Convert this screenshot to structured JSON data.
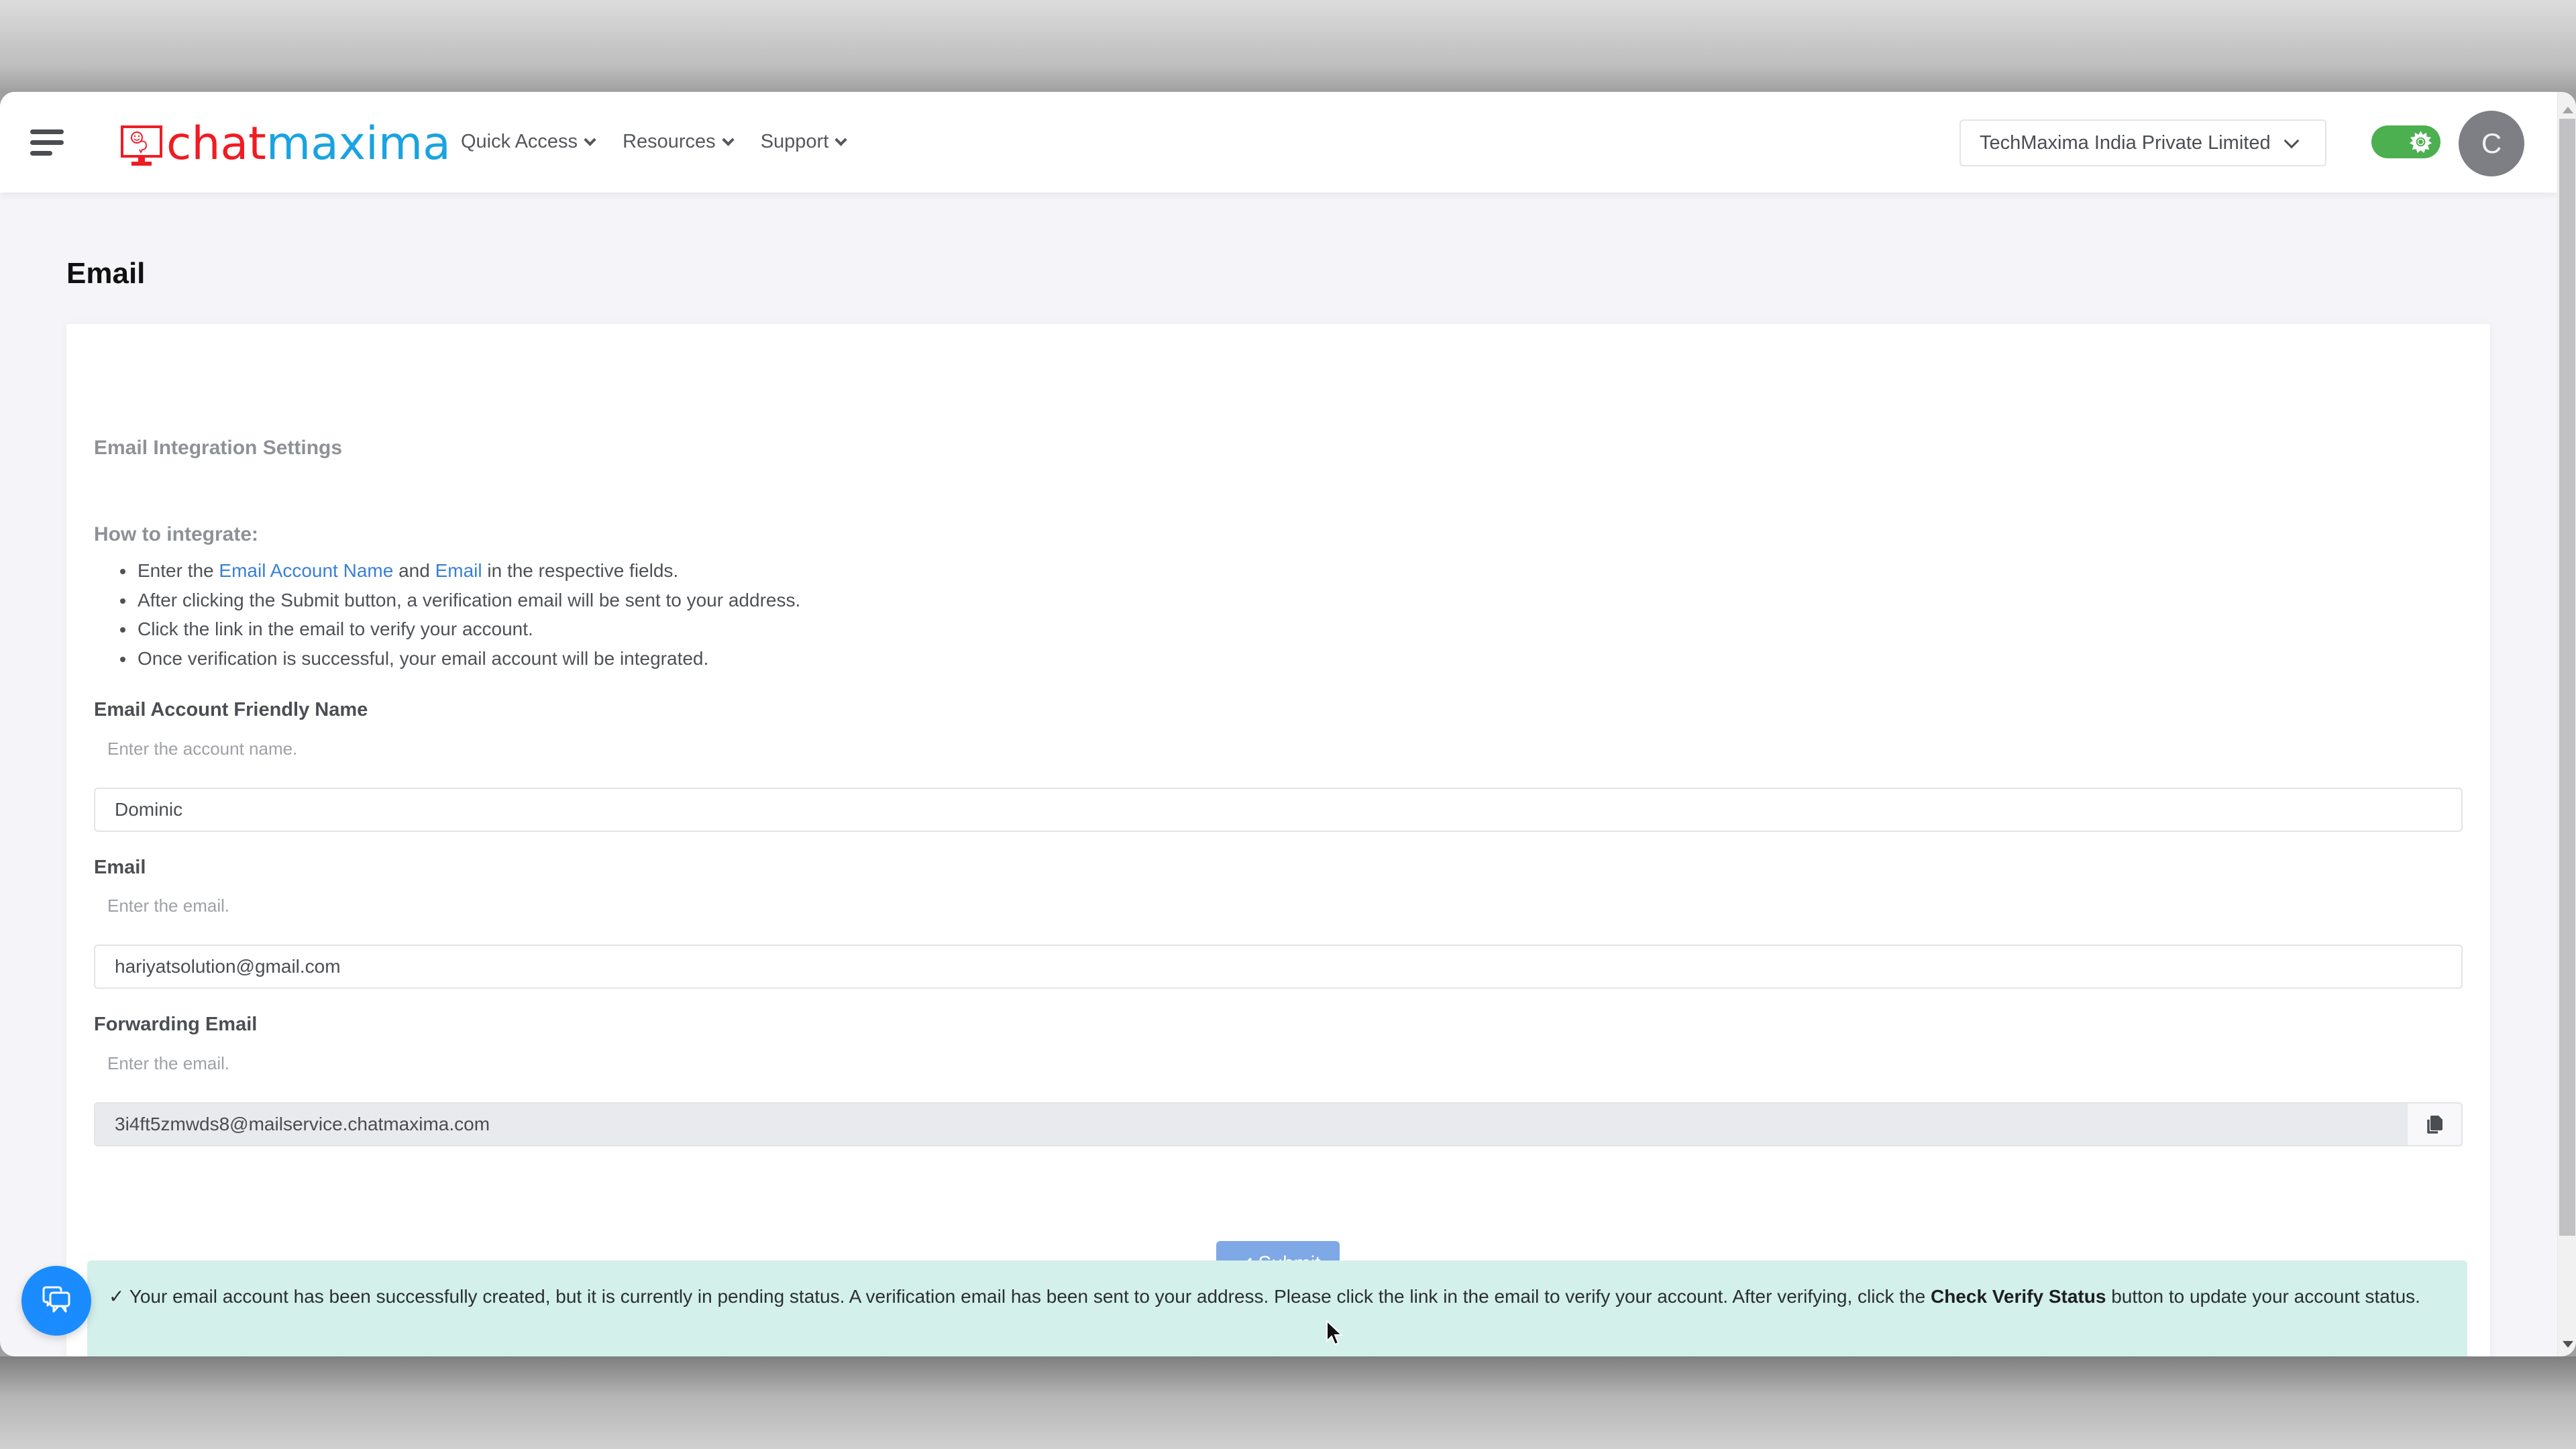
{
  "header": {
    "logo": {
      "part1": "chat",
      "part2": "maxima",
      "icon": "monitor-smiley-logo-icon"
    },
    "menu_icon": "hamburger-menu-icon",
    "nav": [
      {
        "label": "Quick Access",
        "icon": "chevron-down-icon"
      },
      {
        "label": "Resources",
        "icon": "chevron-down-icon"
      },
      {
        "label": "Support",
        "icon": "chevron-down-icon"
      }
    ],
    "organization_select": {
      "value": "TechMaxima India Private Limited",
      "icon": "chevron-down-icon"
    },
    "theme_toggle": {
      "state": "on",
      "icon": "sun-icon",
      "color": "#4caf50"
    },
    "avatar": {
      "initial": "C"
    }
  },
  "page": {
    "title": "Email",
    "card": {
      "title": "Email Integration Settings",
      "how_title": "How to integrate:",
      "steps": [
        {
          "prefix": "Enter the ",
          "link1": "Email Account Name",
          "mid": " and ",
          "link2": "Email",
          "suffix": " in the respective fields."
        },
        {
          "text": "After clicking the Submit button, a verification email will be sent to your address."
        },
        {
          "text": "Click the link in the email to verify your account."
        },
        {
          "text": "Once verification is successful, your email account will be integrated."
        }
      ],
      "fields": [
        {
          "label": "Email Account Friendly Name",
          "hint": "Enter the account name.",
          "value": "Dominic"
        },
        {
          "label": "Email",
          "hint": "Enter the email.",
          "value": "hariyatsolution@gmail.com"
        },
        {
          "label": "Forwarding Email",
          "hint": "Enter the email.",
          "value": "3i4ft5zmwds8@mailservice.chatmaxima.com",
          "readonly": true,
          "action_icon": "copy-icon"
        }
      ],
      "submit": {
        "label": "Submit",
        "icon": "check-icon",
        "color": "#7fa8e6"
      }
    },
    "alert": {
      "icon": "check-icon",
      "text_before": "Your email account has been successfully created, but it is currently in pending status. A verification email has been sent to your address. Please click the link in the email to verify your account. After verifying, click the ",
      "bold": "Check Verify Status",
      "text_after": " button to update your account status.",
      "background": "#d3f0ea"
    }
  },
  "chat_widget": {
    "icon": "chat-bubbles-icon",
    "color": "#1a8cff"
  },
  "colors": {
    "brand_red": "#ef1c24",
    "brand_blue": "#1aa3e0",
    "link": "#3a7fd5"
  }
}
